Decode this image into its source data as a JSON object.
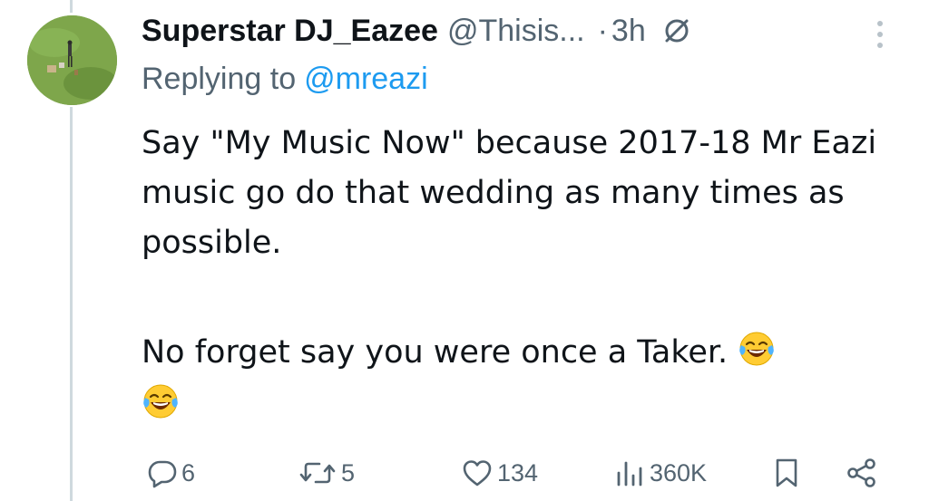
{
  "tweet": {
    "display_name": "Superstar DJ_Eazee",
    "handle": "@Thisis...",
    "separator": "·",
    "time": "3h",
    "replying_prefix": "Replying to",
    "replying_handle": "@mreazi",
    "text_paragraph_1": "Say \"My Music Now\" because 2017-18 Mr Eazi music go do that wedding as many times as possible.",
    "text_paragraph_2": "No forget say you were once a Taker.",
    "emoji_name": "face-with-tears-of-joy-emoji"
  },
  "actions": {
    "reply_count": "6",
    "repost_count": "5",
    "like_count": "134",
    "views_count": "360K"
  },
  "colors": {
    "primary_text": "#0f1419",
    "secondary_text": "#536471",
    "link": "#1d9bf0",
    "thread_line": "#cfd9de"
  }
}
